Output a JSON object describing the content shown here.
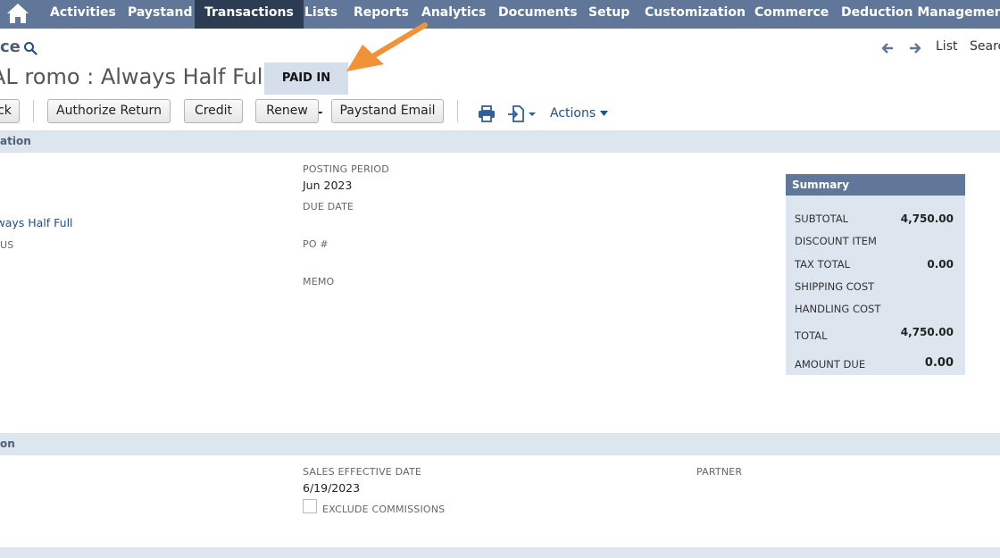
{
  "nav": {
    "items": [
      "Activities",
      "Paystand",
      "Transactions",
      "Lists",
      "Reports",
      "Analytics",
      "Documents",
      "Setup",
      "Customization",
      "Commerce",
      "Deduction Management"
    ],
    "active": "Transactions"
  },
  "header": {
    "title_fragment": "ce",
    "record_title": "AL romo : Always Half Full",
    "status": "PAID IN FULL",
    "right_links": {
      "list": "List",
      "search": "Search"
    }
  },
  "toolbar": {
    "back_fragment": "ck",
    "buttons": [
      "Authorize Return",
      "Credit",
      "Renew",
      "Paystand Email"
    ],
    "actions_label": "Actions"
  },
  "primary": {
    "section_label": "ation",
    "customer_link": "lways Half Full",
    "status_label_fragment": "US",
    "posting_period_label": "POSTING PERIOD",
    "posting_period_value": "Jun 2023",
    "due_date_label": "DUE DATE",
    "po_label": "PO #",
    "memo_label": "MEMO"
  },
  "summary": {
    "title": "Summary",
    "rows": [
      {
        "label": "SUBTOTAL",
        "value": "4,750.00"
      },
      {
        "label": "DISCOUNT ITEM",
        "value": ""
      },
      {
        "label": "TAX TOTAL",
        "value": "0.00"
      },
      {
        "label": "SHIPPING COST",
        "value": ""
      },
      {
        "label": "HANDLING COST",
        "value": ""
      },
      {
        "label": "TOTAL",
        "value": "4,750.00"
      },
      {
        "label": "AMOUNT DUE",
        "value": "0.00"
      }
    ]
  },
  "sales": {
    "section_label": "on",
    "effective_date_label": "SALES EFFECTIVE DATE",
    "effective_date_value": "6/19/2023",
    "exclude_commissions_label": "EXCLUDE COMMISSIONS",
    "partner_label": "PARTNER"
  },
  "colors": {
    "nav_bg": "#607799",
    "nav_active": "#2c3c52",
    "section_bg": "#dde5ef",
    "link": "#1d4f8a",
    "arrow": "#f0923a"
  }
}
